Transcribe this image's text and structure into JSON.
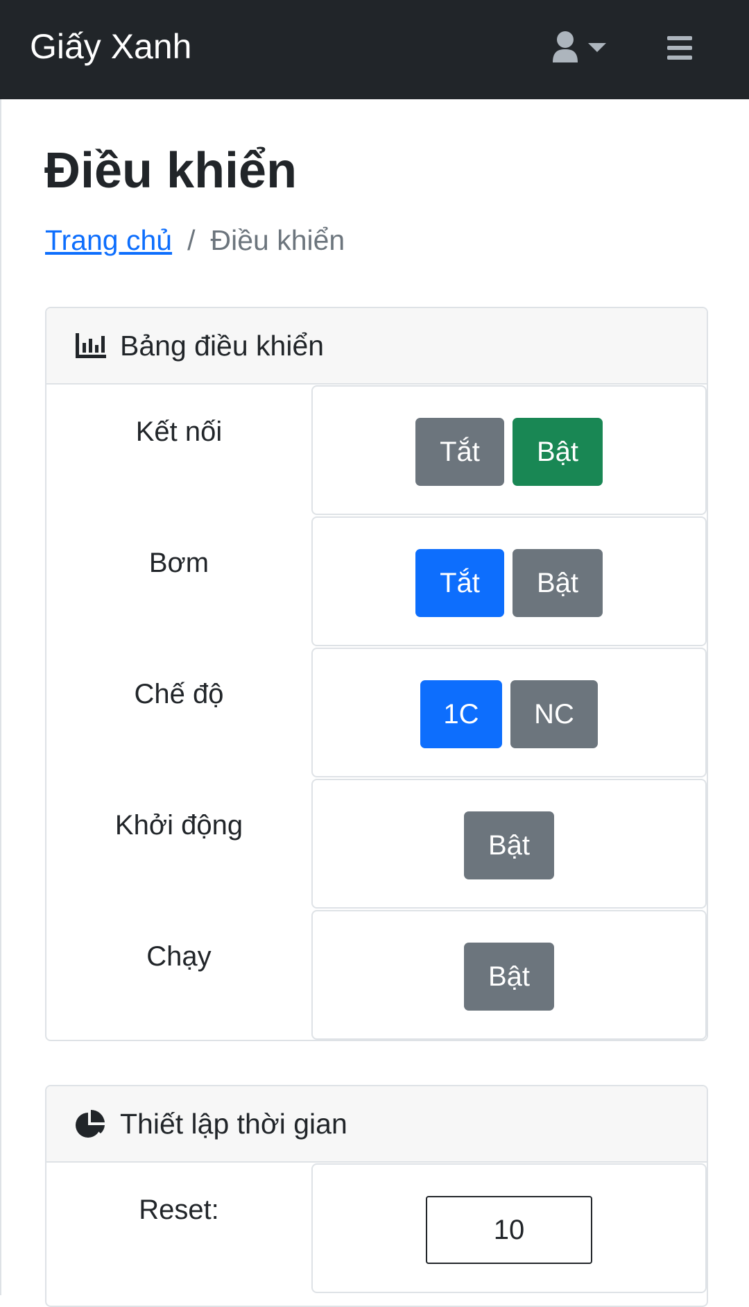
{
  "navbar": {
    "brand": "Giấy Xanh",
    "user_icon": "user-icon",
    "caret_icon": "caret-down-icon",
    "menu_icon": "hamburger-icon"
  },
  "page": {
    "title": "Điều khiển",
    "breadcrumb": {
      "home": "Trang chủ",
      "separator": "/",
      "current": "Điều khiển"
    }
  },
  "control_panel": {
    "title": "Bảng điều khiển",
    "icon": "chart-bar-icon",
    "rows": [
      {
        "label": "Kết nối",
        "buttons": [
          {
            "label": "Tắt",
            "state": "secondary"
          },
          {
            "label": "Bật",
            "state": "success"
          }
        ]
      },
      {
        "label": "Bơm",
        "buttons": [
          {
            "label": "Tắt",
            "state": "primary"
          },
          {
            "label": "Bật",
            "state": "secondary"
          }
        ]
      },
      {
        "label": "Chế độ",
        "buttons": [
          {
            "label": "1C",
            "state": "primary"
          },
          {
            "label": "NC",
            "state": "secondary"
          }
        ]
      },
      {
        "label": "Khởi động",
        "buttons": [
          {
            "label": "Bật",
            "state": "secondary"
          }
        ]
      },
      {
        "label": "Chạy",
        "buttons": [
          {
            "label": "Bật",
            "state": "secondary"
          }
        ]
      }
    ]
  },
  "time_settings": {
    "title": "Thiết lập thời gian",
    "icon": "chart-pie-icon",
    "rows": [
      {
        "label": "Reset:",
        "value": "10"
      }
    ]
  },
  "colors": {
    "navbar": "#212529",
    "primary": "#0d6efd",
    "success": "#198754",
    "secondary": "#6c757d"
  }
}
